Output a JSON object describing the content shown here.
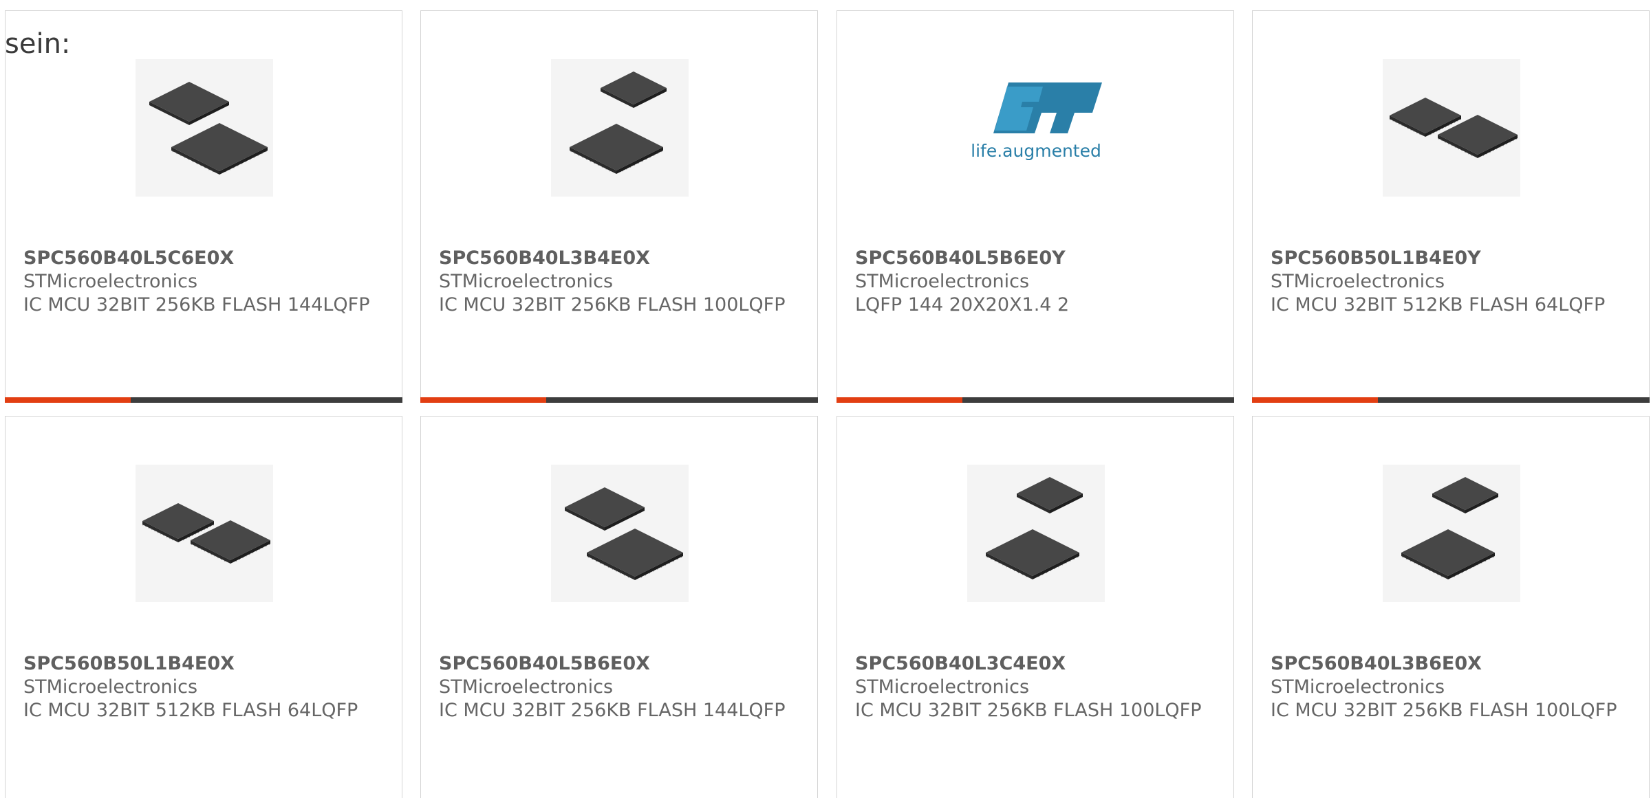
{
  "intro_text": "sein:",
  "colors": {
    "accent_bar": "#e23e12",
    "bar": "#3d3d3d",
    "text": "#666666",
    "border": "#d4d4d4"
  },
  "products": [
    {
      "part": "SPC560B40L5C6E0X",
      "manufacturer": "STMicroelectronics",
      "description": "IC MCU 32BIT 256KB FLASH 144LQFP",
      "image": "chip-pair-large-icon",
      "has_bar": true
    },
    {
      "part": "SPC560B40L3B4E0X",
      "manufacturer": "STMicroelectronics",
      "description": "IC MCU 32BIT 256KB FLASH 100LQFP",
      "image": "chip-pair-small-icon",
      "has_bar": true
    },
    {
      "part": "SPC560B40L5B6E0Y",
      "manufacturer": "STMicroelectronics",
      "description": "LQFP 144 20X20X1.4 2",
      "image": "st-logo",
      "logo_text": "life.augmented",
      "has_bar": true
    },
    {
      "part": "SPC560B50L1B4E0Y",
      "manufacturer": "STMicroelectronics",
      "description": "IC MCU 32BIT 512KB FLASH 64LQFP",
      "image": "chip-pair-side-icon",
      "has_bar": true
    },
    {
      "part": "SPC560B50L1B4E0X",
      "manufacturer": "STMicroelectronics",
      "description": "IC MCU 32BIT 512KB FLASH 64LQFP",
      "image": "chip-pair-side-icon",
      "has_bar": false
    },
    {
      "part": "SPC560B40L5B6E0X",
      "manufacturer": "STMicroelectronics",
      "description": "IC MCU 32BIT 256KB FLASH 144LQFP",
      "image": "chip-pair-large-icon",
      "has_bar": false
    },
    {
      "part": "SPC560B40L3C4E0X",
      "manufacturer": "STMicroelectronics",
      "description": "IC MCU 32BIT 256KB FLASH 100LQFP",
      "image": "chip-pair-small-icon",
      "has_bar": false
    },
    {
      "part": "SPC560B40L3B6E0X",
      "manufacturer": "STMicroelectronics",
      "description": "IC MCU 32BIT 256KB FLASH 100LQFP",
      "image": "chip-pair-small-icon",
      "has_bar": false
    }
  ]
}
